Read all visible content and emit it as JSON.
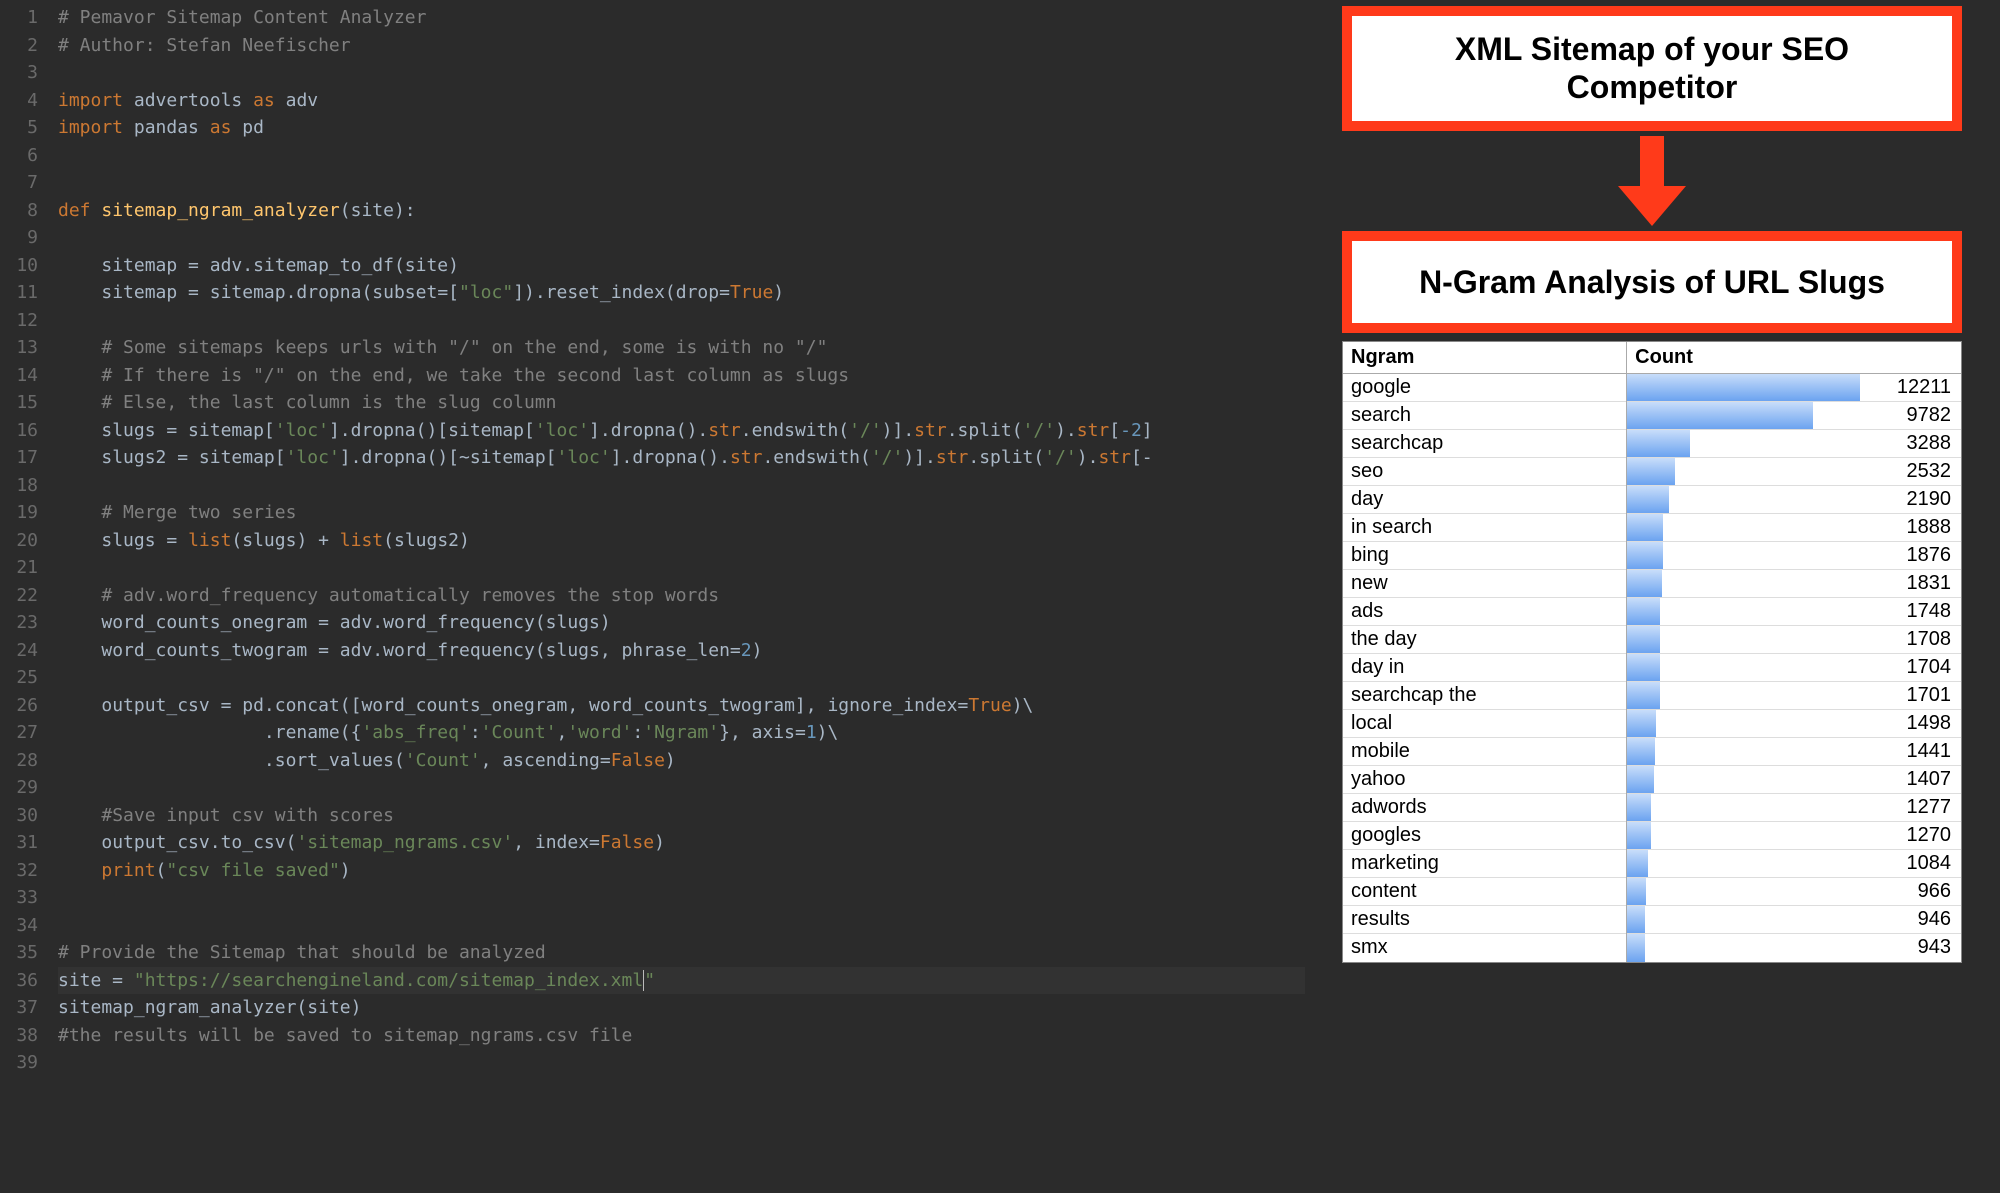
{
  "code": {
    "lines": [
      {
        "n": 1,
        "html": "<span class='c-comment'># Pemavor Sitemap Content Analyzer</span>"
      },
      {
        "n": 2,
        "html": "<span class='c-comment'># Author: Stefan Neefischer</span>"
      },
      {
        "n": 3,
        "html": ""
      },
      {
        "n": 4,
        "html": "<span class='c-kw'>import</span> <span class='c-txt'>advertools</span> <span class='c-kw'>as</span> <span class='c-txt'>adv</span>"
      },
      {
        "n": 5,
        "html": "<span class='c-kw'>import</span> <span class='c-txt'>pandas</span> <span class='c-kw'>as</span> <span class='c-txt'>pd</span>"
      },
      {
        "n": 6,
        "html": ""
      },
      {
        "n": 7,
        "html": ""
      },
      {
        "n": 8,
        "html": "<span class='c-kw'>def</span> <span class='c-fn'>sitemap_ngram_analyzer</span><span class='c-par'>(site):</span>"
      },
      {
        "n": 9,
        "html": ""
      },
      {
        "n": 10,
        "html": "    <span class='c-txt'>sitemap = adv.sitemap_to_df(site)</span>"
      },
      {
        "n": 11,
        "html": "    <span class='c-txt'>sitemap = sitemap.dropna(</span><span class='c-txt'>subset=[</span><span class='c-str'>\"loc\"</span><span class='c-txt'>]).reset_index(</span><span class='c-txt'>drop=</span><span class='c-bool'>True</span><span class='c-txt'>)</span>"
      },
      {
        "n": 12,
        "html": ""
      },
      {
        "n": 13,
        "html": "    <span class='c-comment'># Some sitemaps keeps urls with \"/\" on the end, some is with no \"/\"</span>"
      },
      {
        "n": 14,
        "html": "    <span class='c-comment'># If there is \"/\" on the end, we take the second last column as slugs</span>"
      },
      {
        "n": 15,
        "html": "    <span class='c-comment'># Else, the last column is the slug column</span>"
      },
      {
        "n": 16,
        "html": "    <span class='c-txt'>slugs = sitemap[</span><span class='c-str'>'loc'</span><span class='c-txt'>].dropna()[sitemap[</span><span class='c-str'>'loc'</span><span class='c-txt'>].dropna().</span><span class='c-kw'>str</span><span class='c-txt'>.endswith(</span><span class='c-str'>'/'</span><span class='c-txt'>)].</span><span class='c-kw'>str</span><span class='c-txt'>.split(</span><span class='c-str'>'/'</span><span class='c-txt'>).</span><span class='c-kw'>str</span><span class='c-txt'>[</span><span class='c-num'>-2</span><span class='c-txt'>]</span>"
      },
      {
        "n": 17,
        "html": "    <span class='c-txt'>slugs2 = sitemap[</span><span class='c-str'>'loc'</span><span class='c-txt'>].dropna()[~sitemap[</span><span class='c-str'>'loc'</span><span class='c-txt'>].dropna().</span><span class='c-kw'>str</span><span class='c-txt'>.endswith(</span><span class='c-str'>'/'</span><span class='c-txt'>)].</span><span class='c-kw'>str</span><span class='c-txt'>.split(</span><span class='c-str'>'/'</span><span class='c-txt'>).</span><span class='c-kw'>str</span><span class='c-txt'>[-</span>"
      },
      {
        "n": 18,
        "html": ""
      },
      {
        "n": 19,
        "html": "    <span class='c-comment'># Merge two series</span>"
      },
      {
        "n": 20,
        "html": "    <span class='c-txt'>slugs = </span><span class='c-kw'>list</span><span class='c-txt'>(slugs) + </span><span class='c-kw'>list</span><span class='c-txt'>(slugs2)</span>"
      },
      {
        "n": 21,
        "html": ""
      },
      {
        "n": 22,
        "html": "    <span class='c-comment'># adv.word_frequency automatically removes the stop words</span>"
      },
      {
        "n": 23,
        "html": "    <span class='c-txt'>word_counts_onegram = adv.word_frequency(slugs)</span>"
      },
      {
        "n": 24,
        "html": "    <span class='c-txt'>word_counts_twogram = adv.word_frequency(slugs, </span><span class='c-txt'>phrase_len=</span><span class='c-num'>2</span><span class='c-txt'>)</span>"
      },
      {
        "n": 25,
        "html": ""
      },
      {
        "n": 26,
        "html": "    <span class='c-txt'>output_csv = pd.concat([word_counts_onegram, word_counts_twogram], </span><span class='c-txt'>ignore_index=</span><span class='c-bool'>True</span><span class='c-txt'>)\\</span>"
      },
      {
        "n": 27,
        "html": "                   <span class='c-txt'>.rename({</span><span class='c-str'>'abs_freq'</span><span class='c-txt'>:</span><span class='c-str'>'Count'</span><span class='c-txt'>,</span><span class='c-str'>'word'</span><span class='c-txt'>:</span><span class='c-str'>'Ngram'</span><span class='c-txt'>}, </span><span class='c-txt'>axis=</span><span class='c-num'>1</span><span class='c-txt'>)\\</span>"
      },
      {
        "n": 28,
        "html": "                   <span class='c-txt'>.sort_values(</span><span class='c-str'>'Count'</span><span class='c-txt'>, </span><span class='c-txt'>ascending=</span><span class='c-bool'>False</span><span class='c-txt'>)</span>"
      },
      {
        "n": 29,
        "html": ""
      },
      {
        "n": 30,
        "html": "    <span class='c-comment'>#Save input csv with scores</span>"
      },
      {
        "n": 31,
        "html": "    <span class='c-txt'>output_csv.to_csv(</span><span class='c-str'>'sitemap_ngrams.csv'</span><span class='c-txt'>, </span><span class='c-txt'>index=</span><span class='c-bool'>False</span><span class='c-txt'>)</span>"
      },
      {
        "n": 32,
        "html": "    <span class='c-kw'>print</span><span class='c-txt'>(</span><span class='c-str'>\"csv file saved\"</span><span class='c-txt'>)</span>"
      },
      {
        "n": 33,
        "html": ""
      },
      {
        "n": 34,
        "html": ""
      },
      {
        "n": 35,
        "html": "<span class='c-comment'># Provide the Sitemap that should be analyzed</span>"
      },
      {
        "n": 36,
        "html": "<span class='c-txt'>site = </span><span class='c-str'>\"https://searchengineland.com/sitemap_index.xml<span style='border-left:1px solid #bbb'>\"</span></span>",
        "hl": true
      },
      {
        "n": 37,
        "html": "<span class='c-txt'>sitemap_ngram_analyzer(site)</span>"
      },
      {
        "n": 38,
        "html": "<span class='c-comment'>#the results will be saved to sitemap_ngrams.csv file</span>"
      },
      {
        "n": 39,
        "html": ""
      }
    ]
  },
  "panel": {
    "box1_line1": "XML Sitemap of your SEO",
    "box1_line2": "Competitor",
    "box2": "N-Gram Analysis of URL Slugs",
    "th_ngram": "Ngram",
    "th_count": "Count"
  },
  "chart_data": {
    "type": "bar",
    "title": "N-Gram Analysis of URL Slugs",
    "xlabel": "Count",
    "ylabel": "Ngram",
    "categories": [
      "google",
      "search",
      "searchcap",
      "seo",
      "day",
      "in search",
      "bing",
      "new",
      "ads",
      "the day",
      "day in",
      "searchcap the",
      "local",
      "mobile",
      "yahoo",
      "adwords",
      "googles",
      "marketing",
      "content",
      "results",
      "smx"
    ],
    "values": [
      12211,
      9782,
      3288,
      2532,
      2190,
      1888,
      1876,
      1831,
      1748,
      1708,
      1704,
      1701,
      1498,
      1441,
      1407,
      1277,
      1270,
      1084,
      966,
      946,
      943
    ],
    "xlim": [
      0,
      12211
    ]
  }
}
